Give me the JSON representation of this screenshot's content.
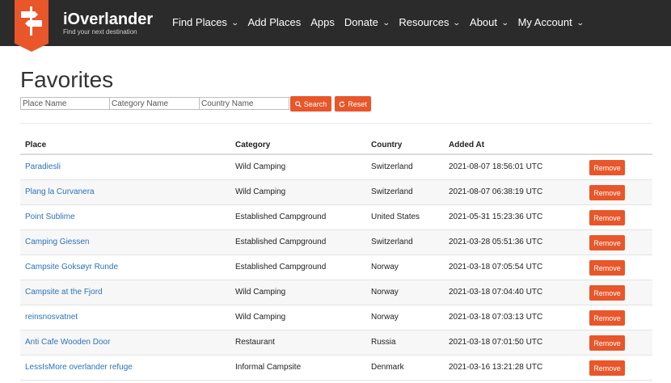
{
  "brand": {
    "name": "iOverlander",
    "tagline": "Find your next destination"
  },
  "nav": [
    {
      "label": "Find Places",
      "dropdown": true
    },
    {
      "label": "Add Places",
      "dropdown": false
    },
    {
      "label": "Apps",
      "dropdown": false
    },
    {
      "label": "Donate",
      "dropdown": true
    },
    {
      "label": "Resources",
      "dropdown": true
    },
    {
      "label": "About",
      "dropdown": true
    },
    {
      "label": "My Account",
      "dropdown": true
    }
  ],
  "page": {
    "title": "Favorites"
  },
  "filters": {
    "place_placeholder": "Place Name",
    "category_placeholder": "Category Name",
    "country_placeholder": "Country Name",
    "search_label": "Search",
    "reset_label": "Reset"
  },
  "table": {
    "headers": {
      "place": "Place",
      "category": "Category",
      "country": "Country",
      "added": "Added At"
    },
    "remove_label": "Remove",
    "rows": [
      {
        "place": "Paradiesli",
        "category": "Wild Camping",
        "country": "Switzerland",
        "added": "2021-08-07 18:56:01 UTC"
      },
      {
        "place": "Plang la Curvanera",
        "category": "Wild Camping",
        "country": "Switzerland",
        "added": "2021-08-07 06:38:19 UTC"
      },
      {
        "place": "Point Sublime",
        "category": "Established Campground",
        "country": "United States",
        "added": "2021-05-31 15:23:36 UTC"
      },
      {
        "place": "Camping Giessen",
        "category": "Established Campground",
        "country": "Switzerland",
        "added": "2021-03-28 05:51:36 UTC"
      },
      {
        "place": "Campsite Goksøyr Runde",
        "category": "Established Campground",
        "country": "Norway",
        "added": "2021-03-18 07:05:54 UTC"
      },
      {
        "place": "Campsite at the Fjord",
        "category": "Wild Camping",
        "country": "Norway",
        "added": "2021-03-18 07:04:40 UTC"
      },
      {
        "place": "reinsnosvatnet",
        "category": "Wild Camping",
        "country": "Norway",
        "added": "2021-03-18 07:03:13 UTC"
      },
      {
        "place": "Anti Cafe Wooden Door",
        "category": "Restaurant",
        "country": "Russia",
        "added": "2021-03-18 07:01:50 UTC"
      },
      {
        "place": "LessIsMore overlander refuge",
        "category": "Informal Campsite",
        "country": "Denmark",
        "added": "2021-03-16 13:21:28 UTC"
      }
    ]
  },
  "colors": {
    "accent": "#e8562a",
    "navbar": "#2b2b2b",
    "link": "#2d72b8"
  },
  "icons": {
    "logo": "signpost-icon",
    "search": "search-icon",
    "reset": "refresh-icon",
    "dropdown": "chevron-down-icon"
  }
}
